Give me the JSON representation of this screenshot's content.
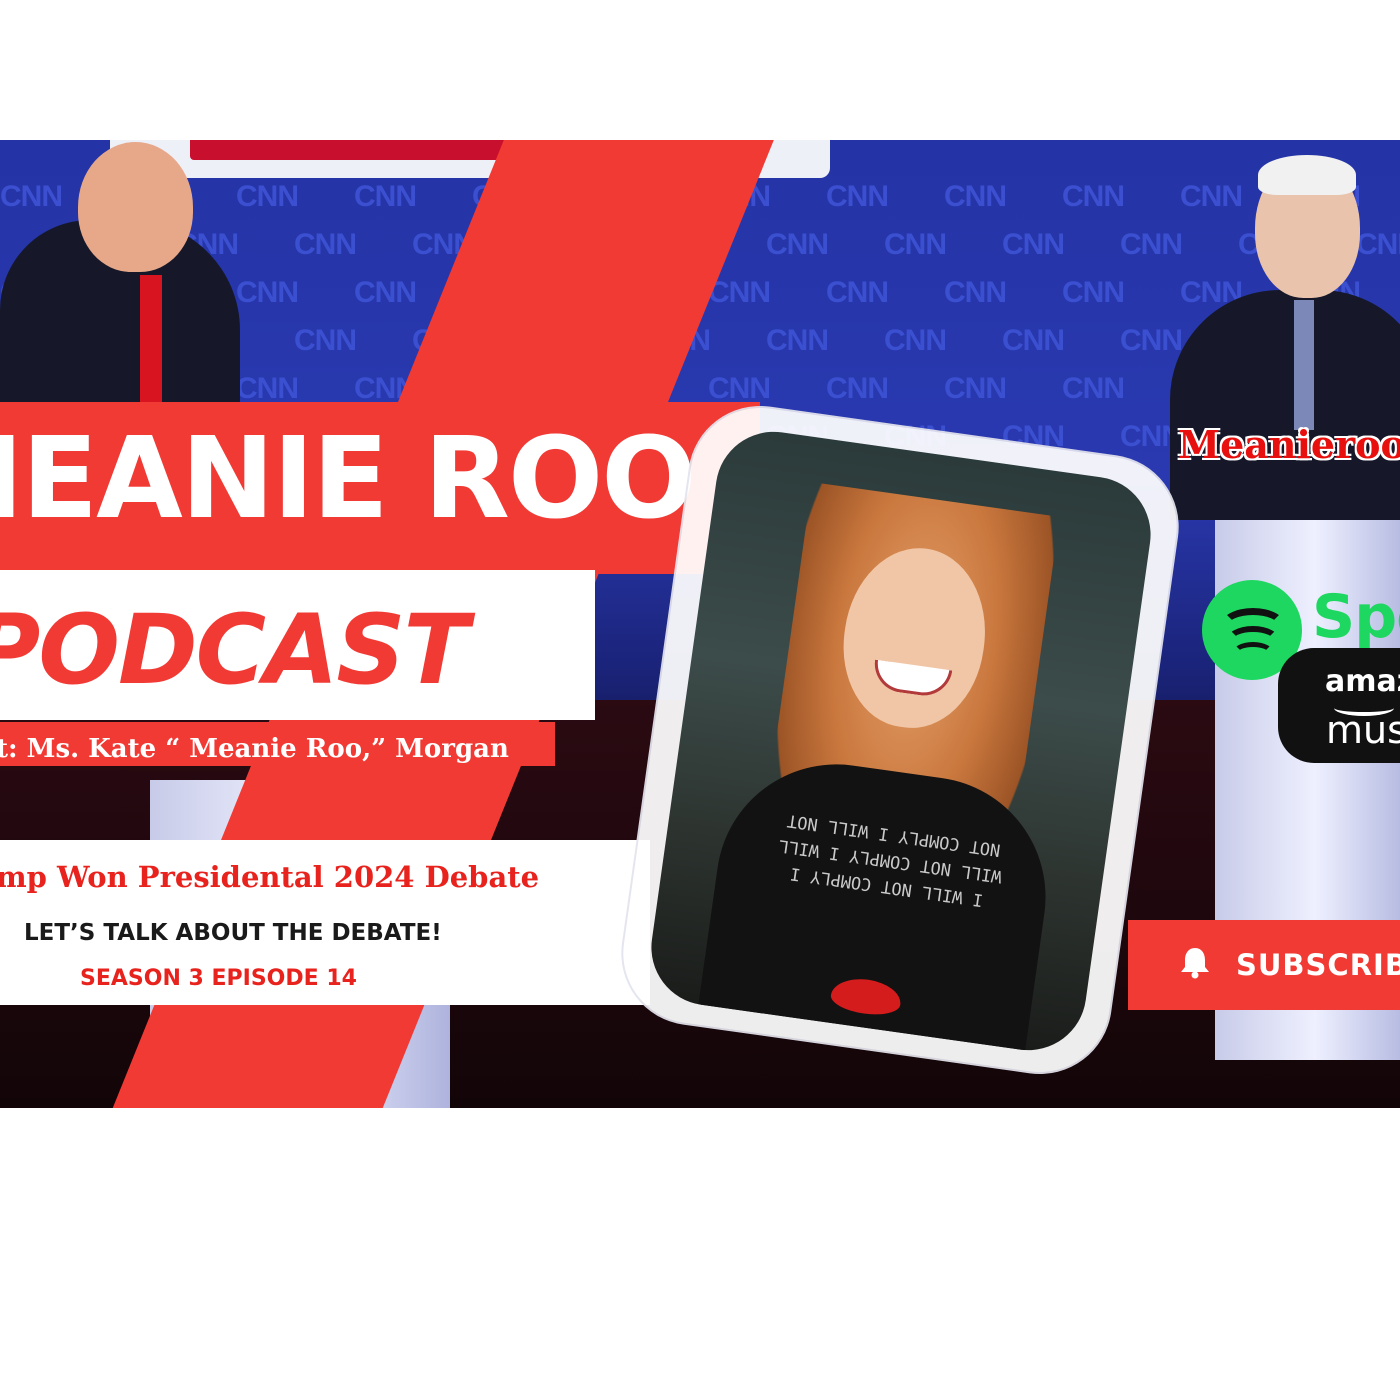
{
  "banner": {
    "title_line_1": "IEANIE ROO",
    "title_line_2": "PODCAST",
    "host_line": "t: Ms. Kate “ Meanie Roo,” Morgan",
    "headline": "mp Won Presidental 2024 Debate",
    "subline_1": "LET’S TALK ABOUT THE DEBATE!",
    "subline_2": "SEASON 3 EPISODE 14",
    "signage_text": "CNN",
    "shirt_text": "I WILL NOT COMPLY I WILL NOT COMPLY I WILL NOT COMPLY I WILL NOT"
  },
  "platforms": {
    "brand_name": "Meanieroo",
    "spotify_label": "Spo",
    "amazon_line_1": "amaz",
    "amazon_line_2": "mus"
  },
  "subscribe": {
    "label": "SUBSCRIB"
  },
  "colors": {
    "accent_red": "#f23a35",
    "stage_blue": "#2434a6",
    "spotify_green": "#1ed760"
  },
  "icons": [
    "bell-icon",
    "spotify-icon",
    "amazon-music-icon"
  ]
}
